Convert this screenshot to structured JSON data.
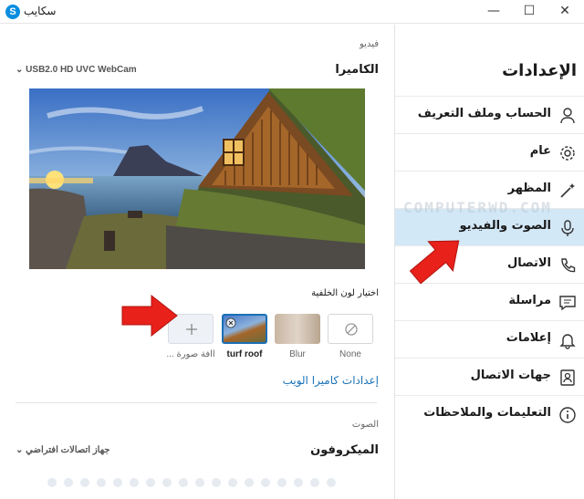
{
  "window": {
    "app_icon": "S",
    "title": "سكايب",
    "minimize": "—",
    "maximize": "☐",
    "close": "✕"
  },
  "sidebar": {
    "title": "الإعدادات",
    "items": [
      {
        "label": "الحساب وملف التعريف",
        "icon": "person-icon"
      },
      {
        "label": "عام",
        "icon": "gear-icon"
      },
      {
        "label": "المظهر",
        "icon": "magic-wand-icon"
      },
      {
        "label": "الصوت والفيديو",
        "icon": "microphone-icon",
        "active": true
      },
      {
        "label": "الاتصال",
        "icon": "phone-icon"
      },
      {
        "label": "مراسلة",
        "icon": "message-icon"
      },
      {
        "label": "إعلامات",
        "icon": "bell-icon"
      },
      {
        "label": "جهات الاتصال",
        "icon": "contact-card-icon"
      },
      {
        "label": "التعليمات والملاحظات",
        "icon": "info-icon"
      }
    ]
  },
  "video": {
    "section_label": "فيديو",
    "camera_label": "الكاميرا",
    "camera_value": "USB2.0 HD UVC WebCam",
    "background_title": "اختيار لون الخلفية",
    "backgrounds": [
      {
        "label": "None",
        "kind": "none"
      },
      {
        "label": "Blur",
        "kind": "blur"
      },
      {
        "label": "turf roof",
        "kind": "image",
        "selected": true
      },
      {
        "label": "... اافة صورة",
        "kind": "add"
      }
    ],
    "webcam_settings_link": "إعدادات كاميرا الويب"
  },
  "audio": {
    "section_label": "الصوت",
    "microphone_label": "الميكروفون",
    "microphone_value": "جهاز اتصالات افتراضي"
  },
  "watermark": "COMPUTERWD.COM",
  "colors": {
    "accent": "#0a8de0",
    "active_nav_bg": "#d3e8f7",
    "link": "#1a73b8",
    "arrow": "#e8211a"
  }
}
